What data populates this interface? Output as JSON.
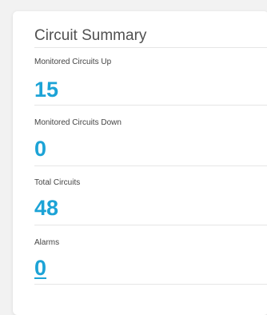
{
  "card": {
    "title": "Circuit Summary"
  },
  "metrics": [
    {
      "label": "Monitored Circuits Up",
      "value": "15"
    },
    {
      "label": "Monitored Circuits Down",
      "value": "0"
    },
    {
      "label": "Total Circuits",
      "value": "48"
    },
    {
      "label": "Alarms",
      "value": "0"
    }
  ],
  "colors": {
    "accent": "#1ca3d6",
    "title": "#505050",
    "label": "#444444",
    "divider": "#e6e6e6",
    "background": "#f2f2f2",
    "card": "#ffffff"
  }
}
